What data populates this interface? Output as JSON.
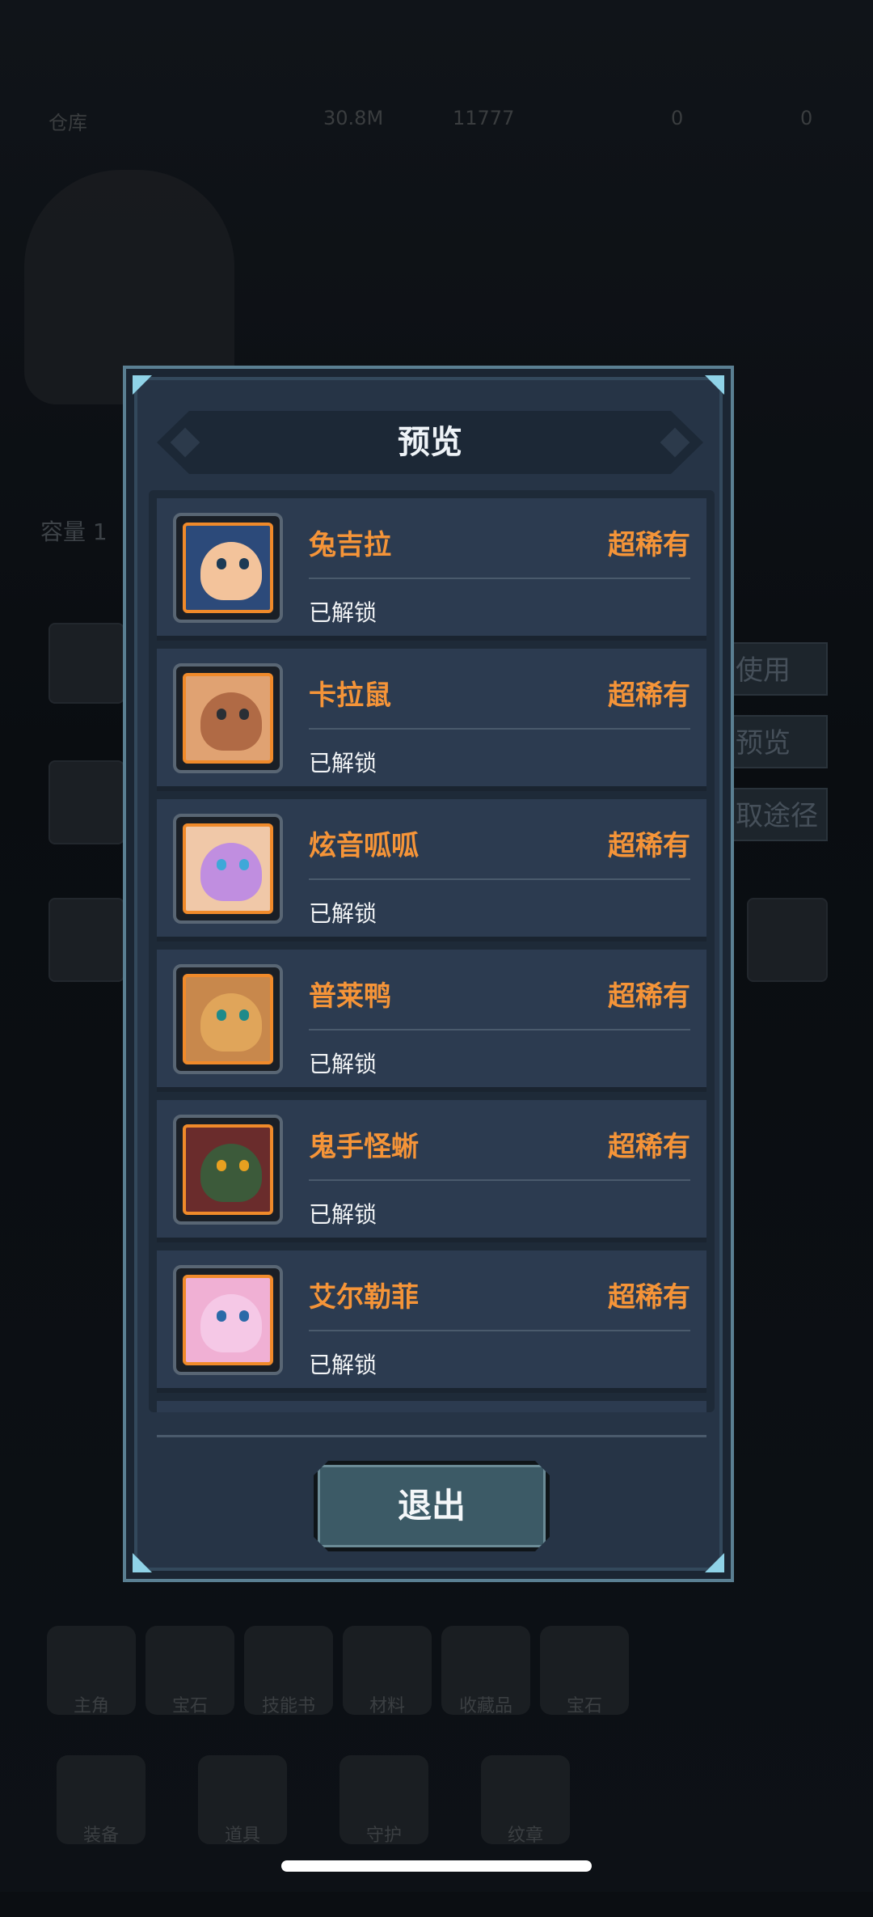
{
  "background": {
    "topbar": {
      "title": "仓库",
      "gold": "30.8M",
      "gems": "11777",
      "res3": "0",
      "res4": "0"
    },
    "capacity_label": "容量 1",
    "side_buttons": [
      "使用",
      "预览",
      "取途径"
    ],
    "tabs_row1": [
      "主角",
      "宝石",
      "技能书",
      "材料",
      "收藏品",
      "宝石"
    ],
    "tabs_row2": [
      "装备",
      "道具",
      "守护",
      "纹章"
    ]
  },
  "modal": {
    "title": "预览",
    "items": [
      {
        "name": "兔吉拉",
        "rarity": "超稀有",
        "status": "已解锁",
        "color": "#f3c39b",
        "bg": "#2c4a7a"
      },
      {
        "name": "卡拉鼠",
        "rarity": "超稀有",
        "status": "已解锁",
        "color": "#b06a45",
        "bg": "#e0a272"
      },
      {
        "name": "炫音呱呱",
        "rarity": "超稀有",
        "status": "已解锁",
        "color": "#c08ee0",
        "bg": "#f0c8a8"
      },
      {
        "name": "普莱鸭",
        "rarity": "超稀有",
        "status": "已解锁",
        "color": "#e0a55a",
        "bg": "#c8884c"
      },
      {
        "name": "鬼手怪蜥",
        "rarity": "超稀有",
        "status": "已解锁",
        "color": "#3c5a3a",
        "bg": "#6a2c2c"
      },
      {
        "name": "艾尔勒菲",
        "rarity": "超稀有",
        "status": "已解锁",
        "color": "#f5c8e6",
        "bg": "#f0b0d4"
      }
    ],
    "exit_label": "退出"
  }
}
